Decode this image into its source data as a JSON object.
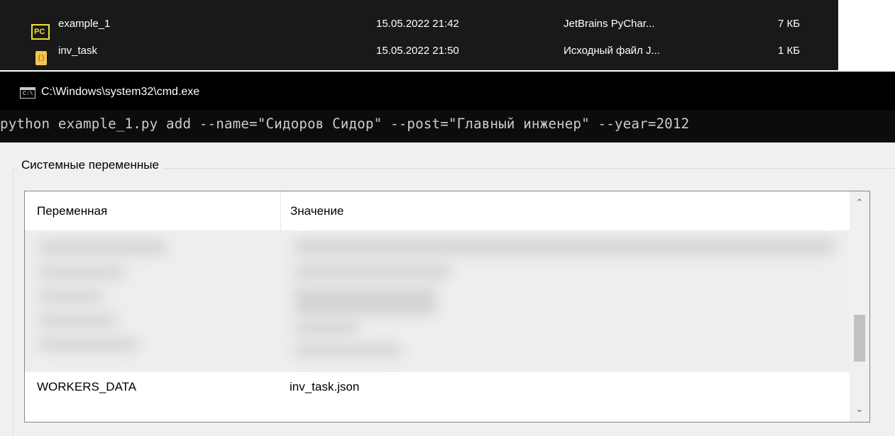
{
  "explorer": {
    "files": [
      {
        "icon": "pycharm-file-icon",
        "icon_glyph": "PC",
        "name": "example_1",
        "date": "15.05.2022 21:42",
        "type": "JetBrains PyChar...",
        "size": "7 КБ"
      },
      {
        "icon": "json-file-icon",
        "icon_glyph": "{}",
        "name": "inv_task",
        "date": "15.05.2022 21:50",
        "type": "Исходный файл J...",
        "size": "1 КБ"
      }
    ]
  },
  "cmd": {
    "title": "C:\\Windows\\system32\\cmd.exe",
    "icon_glyph": "C:\\",
    "command": "python example_1.py add --name=\"Сидоров Сидор\" --post=\"Главный инженер\" --year=2012"
  },
  "sysvars": {
    "group_label": "Системные переменные",
    "columns": {
      "variable": "Переменная",
      "value": "Значение"
    },
    "rows": [
      {
        "variable": "WORKERS_DATA",
        "value": "inv_task.json"
      }
    ],
    "scroll": {
      "position": 0.74,
      "visible_fraction": 0.26
    }
  },
  "colors": {
    "explorer_bg": "#191919",
    "cmd_bg": "#0c0c0c",
    "cmd_text": "#cccccc",
    "dialog_bg": "#f0f0f0",
    "pycharm_accent": "#f2e23a"
  }
}
